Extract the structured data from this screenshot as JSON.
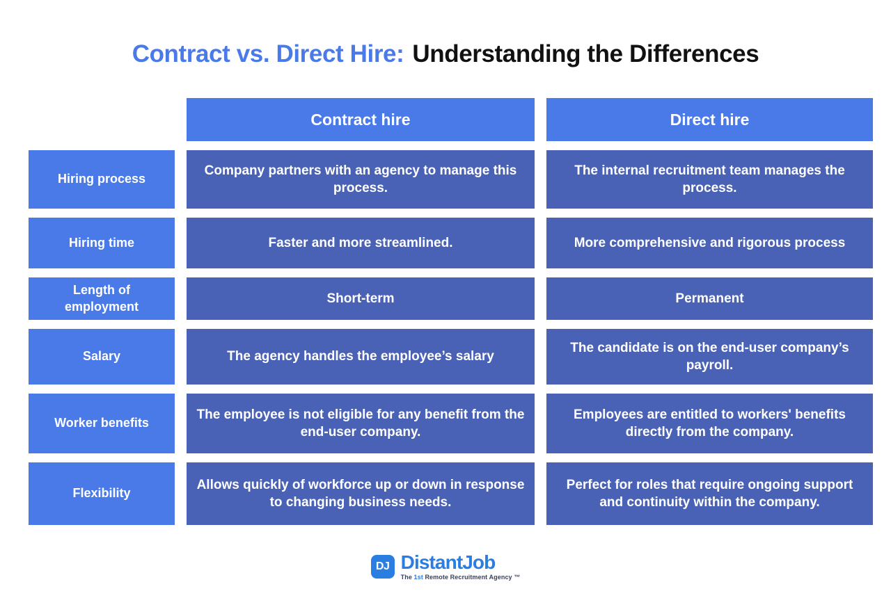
{
  "title": {
    "highlight": "Contract vs. Direct Hire:",
    "rest": "Understanding the Differences",
    "highlight_color": "#4a7ae8",
    "rest_color": "#111111"
  },
  "colors": {
    "header_blue": "#4a7ae8",
    "label_blue": "#4a7ae8",
    "content_blue": "#4a62b5",
    "background": "#ffffff",
    "text_on_blue": "#ffffff",
    "logo_blue": "#2a7de1"
  },
  "table": {
    "corner_label": "",
    "columns": [
      {
        "label": "Contract hire"
      },
      {
        "label": "Direct hire"
      }
    ],
    "rows": [
      {
        "label": "Hiring process",
        "contract": "Company partners with an agency to manage this process.",
        "direct": "The internal recruitment team manages the process."
      },
      {
        "label": "Hiring time",
        "contract": "Faster and more streamlined.",
        "direct": "More comprehensive and rigorous process"
      },
      {
        "label": "Length of employment",
        "contract": "Short-term",
        "direct": "Permanent"
      },
      {
        "label": "Salary",
        "contract": "The agency handles the employee’s salary",
        "direct": "The candidate is on the end-user company’s payroll."
      },
      {
        "label": "Worker benefits",
        "contract": "The employee is not eligible for any benefit from the end-user company.",
        "direct": "Employees are entitled to workers' benefits directly from the company."
      },
      {
        "label": "Flexibility",
        "contract": "Allows quickly of workforce up or down in response to changing business needs.",
        "direct": "Perfect for roles that require ongoing support and continuity within the company."
      }
    ]
  },
  "footer": {
    "logo_mark": "DJ",
    "logo_name": "DistantJob",
    "tagline_prefix": "The ",
    "tagline_highlight": "1st",
    "tagline_suffix": " Remote Recruitment Agency ™"
  }
}
